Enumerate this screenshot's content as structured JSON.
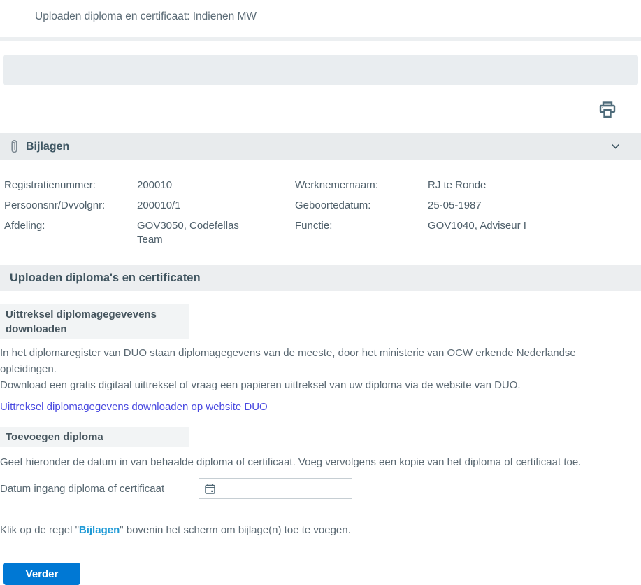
{
  "page": {
    "title": "Uploaden diploma en certificaat: Indienen MW"
  },
  "toolbar": {
    "printer_icon": "printer"
  },
  "bijlagen_bar": {
    "label": "Bijlagen",
    "leading_icon": "paperclip",
    "trailing_icon": "chevron-down"
  },
  "details": {
    "left": [
      {
        "label": "Registratienummer:",
        "value": "200010"
      },
      {
        "label": "Persoonsnr/Dvvolgnr:",
        "value": "200010/1"
      },
      {
        "label": "Afdeling:",
        "value": "GOV3050, Codefellas Team"
      }
    ],
    "right": [
      {
        "label": "Werknemernaam:",
        "value": "RJ te Ronde"
      },
      {
        "label": "Geboortedatum:",
        "value": "25-05-1987"
      },
      {
        "label": "Functie:",
        "value": "GOV1040, Adviseur I"
      }
    ]
  },
  "section": {
    "title": "Uploaden diploma's en certificaten",
    "download_block": {
      "heading": "Uittreksel diplomagegevevens downloaden",
      "paragraph_line1": "In het diplomaregister van DUO staan diplomagegevens van de meeste, door het ministerie van OCW erkende Nederlandse opleidingen.",
      "paragraph_line2": "Download een gratis digitaal uittreksel of vraag een papieren uittreksel van uw diploma via de website van DUO.",
      "link_label": "Uittreksel diplomagegevens downloaden op website DUO"
    },
    "add_block": {
      "heading": "Toevoegen diploma",
      "paragraph": "Geef hieronder de datum in van behaalde diploma of certificaat. Voeg vervolgens een kopie van het diploma of certificaat toe.",
      "date_label": "Datum ingang diploma of certificaat",
      "date_value": "",
      "calendar_icon": "calendar"
    },
    "note_prefix": "Klik op de regel \"",
    "note_bold": "Bijlagen",
    "note_suffix": "\" bovenin het scherm om bijlage(n) toe te voegen."
  },
  "actions": {
    "continue_label": "Verder"
  },
  "colors": {
    "accent_blue": "#0078d4",
    "link_blue": "#4848e0",
    "inline_link_blue": "#1f9ad6",
    "slate_text": "#3e5663",
    "bar_gray": "#e8ebed",
    "panel_gray": "#e9edf0"
  }
}
